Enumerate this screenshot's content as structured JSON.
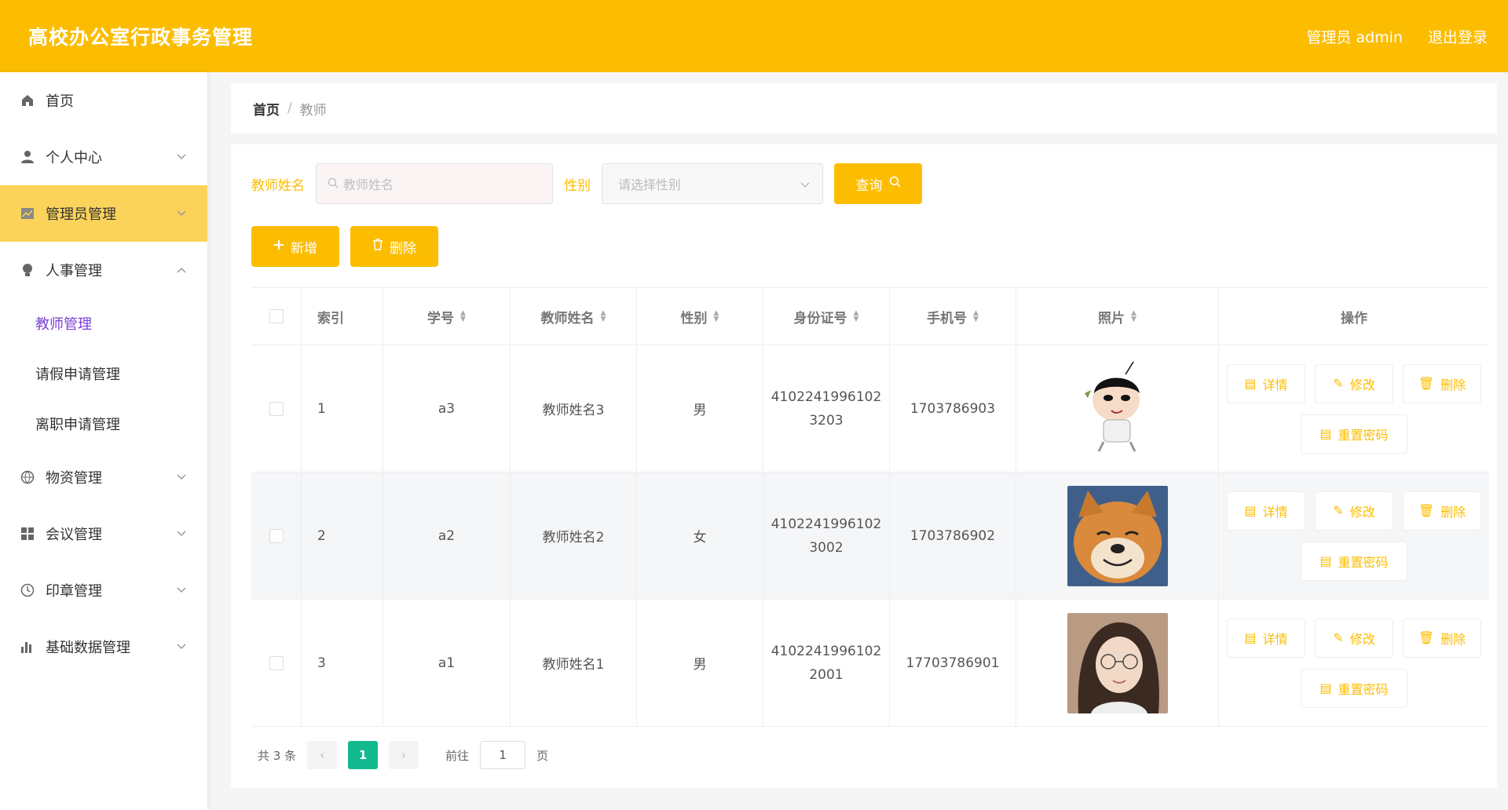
{
  "header": {
    "title": "高校办公室行政事务管理",
    "user": "管理员 admin",
    "logout": "退出登录"
  },
  "sidebar": {
    "items": [
      {
        "label": "首页",
        "icon": "home-icon"
      },
      {
        "label": "个人中心",
        "icon": "user-icon"
      },
      {
        "label": "管理员管理",
        "icon": "chart-icon"
      },
      {
        "label": "人事管理",
        "icon": "bulb-icon"
      },
      {
        "label": "物资管理",
        "icon": "globe-icon"
      },
      {
        "label": "会议管理",
        "icon": "grid-icon"
      },
      {
        "label": "印章管理",
        "icon": "clock-icon"
      },
      {
        "label": "基础数据管理",
        "icon": "bar-icon"
      }
    ],
    "sub": [
      "教师管理",
      "请假申请管理",
      "离职申请管理"
    ]
  },
  "breadcrumb": {
    "home": "首页",
    "sep": "/",
    "current": "教师"
  },
  "filter": {
    "name_label": "教师姓名",
    "name_placeholder": "教师姓名",
    "sex_label": "性别",
    "sex_placeholder": "请选择性别",
    "query": "查询"
  },
  "actions": {
    "add": "新增",
    "delete": "删除"
  },
  "table": {
    "headers": {
      "index": "索引",
      "xh": "学号",
      "name": "教师姓名",
      "sex": "性别",
      "id": "身份证号",
      "phone": "手机号",
      "photo": "照片",
      "op": "操作"
    },
    "rows": [
      {
        "index": "1",
        "xh": "a3",
        "name": "教师姓名3",
        "sex": "男",
        "id1": "4102241996102",
        "id2": "3203",
        "phone": "1703786903"
      },
      {
        "index": "2",
        "xh": "a2",
        "name": "教师姓名2",
        "sex": "女",
        "id1": "4102241996102",
        "id2": "3002",
        "phone": "1703786902"
      },
      {
        "index": "3",
        "xh": "a1",
        "name": "教师姓名1",
        "sex": "男",
        "id1": "4102241996102",
        "id2": "2001",
        "phone": "17703786901"
      }
    ],
    "ops": {
      "detail": "详情",
      "edit": "修改",
      "delete": "删除",
      "reset": "重置密码"
    }
  },
  "pagination": {
    "total": "共 3 条",
    "page": "1",
    "goto": "前往",
    "goto_value": "1",
    "unit": "页"
  },
  "colors": {
    "brand": "#fcbd00",
    "active_menu": "#fcd35a",
    "current_sub": "#7b3fd4",
    "page_active": "#13b88f"
  }
}
